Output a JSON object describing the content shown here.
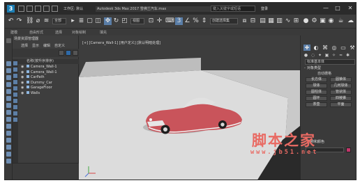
{
  "titlebar": {
    "workspace_label": "工作区: 默认",
    "title": "Autodesk 3ds Max 2017   雪佛兰汽车.max",
    "search_placeholder": "键入关键字或短语",
    "user_label": "登录",
    "minimize": "—",
    "maximize": "□",
    "close": "✕"
  },
  "toolbar": {
    "selection_filter": "全部",
    "view_mode": "视图",
    "named_selection": "创建选择集"
  },
  "ribbon": {
    "tabs": [
      "建模",
      "自由形式",
      "选择",
      "对象绘制",
      "填充"
    ]
  },
  "explorer": {
    "title": "场景资源管理器",
    "menu": [
      "选择",
      "显示",
      "编辑",
      "自定义"
    ],
    "column_header": "名称(按升序排序)",
    "items": [
      {
        "label": "Camera_Wall-1"
      },
      {
        "label": "Camera_Wall-1"
      },
      {
        "label": "CarPath"
      },
      {
        "label": "Dummy_Car"
      },
      {
        "label": "GarageFloor"
      },
      {
        "label": "Walls"
      }
    ]
  },
  "viewport": {
    "label": "[+] [Camera_Wall-1] [用户定义] [默认明暗处理]"
  },
  "command_panel": {
    "object_type_dropdown": "标准基本体",
    "section_object_type": "对象类型",
    "auto_grid": "自动栅格",
    "buttons": [
      "长方体",
      "圆锥体",
      "球体",
      "几何球体",
      "圆柱体",
      "管状体",
      "圆环",
      "四棱锥",
      "茶壶",
      "平面"
    ],
    "section_name_color": "名称和颜色",
    "swatch_color": "#c2356a"
  },
  "watermark": {
    "chinese": "脚本之家",
    "url": "www.jb51.net"
  },
  "colors": {
    "accent": "#5a7ea8",
    "car_body": "#c9545b",
    "watermark": "#e96a63"
  }
}
